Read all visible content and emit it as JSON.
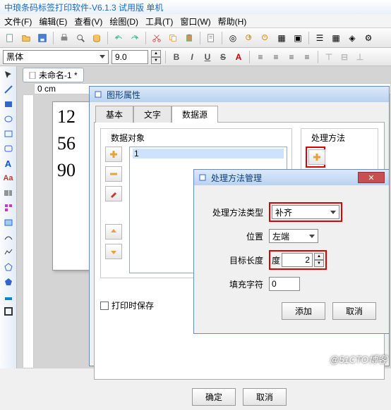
{
  "app": {
    "title": "中琅条码标签打印软件-V6.1.3 试用版 单机"
  },
  "menu": {
    "file": "文件(F)",
    "edit": "编辑(E)",
    "view": "查看(V)",
    "draw": "绘图(D)",
    "tools": "工具(T)",
    "window": "窗口(W)",
    "help": "帮助(H)"
  },
  "font": {
    "name": "黑体",
    "size": "9.0",
    "bold": "B",
    "italic": "I",
    "under": "U",
    "strike": "S"
  },
  "doc": {
    "tab": "未命名-1 *",
    "ruler": "0 cm"
  },
  "canvas": {
    "l1": "12",
    "l2": "56",
    "l3": "90"
  },
  "prop_dlg": {
    "title": "图形属性",
    "tabs": {
      "basic": "基本",
      "text": "文字",
      "data": "数据源"
    },
    "section_data": "数据对象",
    "section_proc": "处理方法",
    "listval": "1",
    "chk": "打印时保存",
    "ok": "确定",
    "cancel": "取消"
  },
  "proc_dlg": {
    "title": "处理方法管理",
    "type_label": "处理方法类型",
    "type_value": "补齐",
    "pos_label": "位置",
    "pos_value": "左端",
    "len_label": "目标长度",
    "len_value": "2",
    "len_marker": "度",
    "fill_label": "填充字符",
    "fill_value": "0",
    "add": "添加",
    "cancel": "取消"
  },
  "watermark": "@51CTO博客"
}
